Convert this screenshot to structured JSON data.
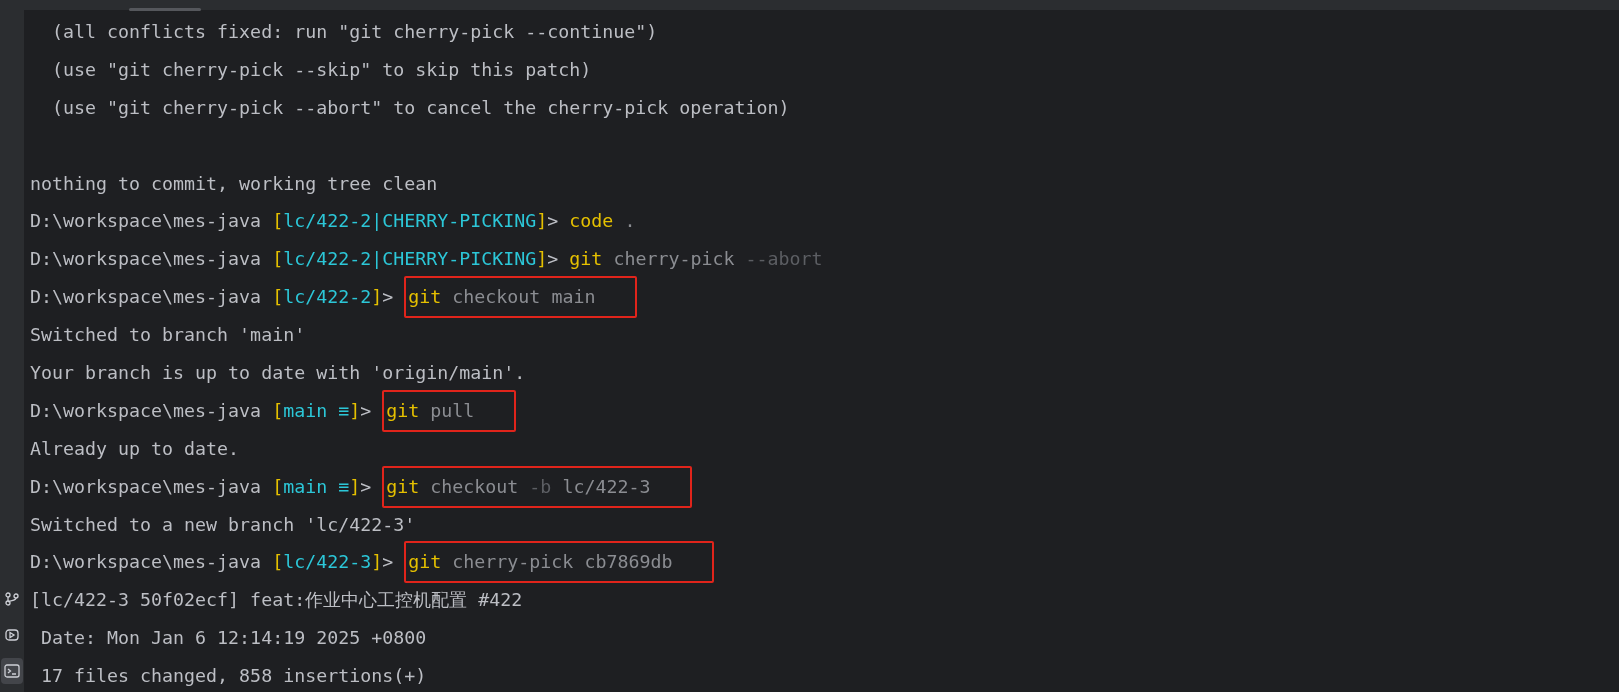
{
  "sidebar": {
    "items": [
      {
        "kind": "branch",
        "selected": false
      },
      {
        "kind": "run",
        "selected": false
      },
      {
        "kind": "terminal",
        "selected": true
      }
    ]
  },
  "terminal": {
    "lines": [
      {
        "kind": "output",
        "text": "  (all conflicts fixed: run \"git cherry-pick --continue\")"
      },
      {
        "kind": "output",
        "text": "  (use \"git cherry-pick --skip\" to skip this patch)"
      },
      {
        "kind": "output",
        "text": "  (use \"git cherry-pick --abort\" to cancel the cherry-pick operation)"
      },
      {
        "kind": "blank"
      },
      {
        "kind": "output",
        "text": "nothing to commit, working tree clean"
      },
      {
        "kind": "prompt",
        "prompt": [
          {
            "kind": "path",
            "text": "D:\\workspace\\mes-java "
          },
          {
            "kind": "bracket",
            "text": "["
          },
          {
            "kind": "branch",
            "text": "lc/422-2|CHERRY-PICKING"
          },
          {
            "kind": "bracket",
            "text": "]"
          },
          {
            "kind": "arrow",
            "text": "> "
          }
        ],
        "highlighted": false,
        "command": [
          {
            "kind": "command",
            "text": "code"
          },
          {
            "kind": "arg",
            "text": "."
          }
        ]
      },
      {
        "kind": "prompt",
        "prompt": [
          {
            "kind": "path",
            "text": "D:\\workspace\\mes-java "
          },
          {
            "kind": "bracket",
            "text": "["
          },
          {
            "kind": "branch",
            "text": "lc/422-2|CHERRY-PICKING"
          },
          {
            "kind": "bracket",
            "text": "]"
          },
          {
            "kind": "arrow",
            "text": "> "
          }
        ],
        "highlighted": false,
        "command": [
          {
            "kind": "command",
            "text": "git"
          },
          {
            "kind": "arg",
            "text": "cherry-pick"
          },
          {
            "kind": "option",
            "text": "--abort"
          }
        ]
      },
      {
        "kind": "prompt",
        "prompt": [
          {
            "kind": "path",
            "text": "D:\\workspace\\mes-java "
          },
          {
            "kind": "bracket",
            "text": "["
          },
          {
            "kind": "branch",
            "text": "lc/422-2"
          },
          {
            "kind": "bracket",
            "text": "]"
          },
          {
            "kind": "arrow",
            "text": "> "
          }
        ],
        "highlighted": true,
        "command": [
          {
            "kind": "command",
            "text": "git"
          },
          {
            "kind": "arg",
            "text": "checkout"
          },
          {
            "kind": "arg",
            "text": "main"
          }
        ]
      },
      {
        "kind": "output",
        "text": "Switched to branch 'main'"
      },
      {
        "kind": "output",
        "text": "Your branch is up to date with 'origin/main'."
      },
      {
        "kind": "prompt",
        "prompt": [
          {
            "kind": "path",
            "text": "D:\\workspace\\mes-java "
          },
          {
            "kind": "bracket",
            "text": "["
          },
          {
            "kind": "branch",
            "text": "main ≡"
          },
          {
            "kind": "bracket",
            "text": "]"
          },
          {
            "kind": "arrow",
            "text": "> "
          }
        ],
        "highlighted": true,
        "command": [
          {
            "kind": "command",
            "text": "git"
          },
          {
            "kind": "arg",
            "text": "pull"
          }
        ]
      },
      {
        "kind": "output",
        "text": "Already up to date."
      },
      {
        "kind": "prompt",
        "prompt": [
          {
            "kind": "path",
            "text": "D:\\workspace\\mes-java "
          },
          {
            "kind": "bracket",
            "text": "["
          },
          {
            "kind": "branch",
            "text": "main ≡"
          },
          {
            "kind": "bracket",
            "text": "]"
          },
          {
            "kind": "arrow",
            "text": "> "
          }
        ],
        "highlighted": true,
        "command": [
          {
            "kind": "command",
            "text": "git"
          },
          {
            "kind": "arg",
            "text": "checkout"
          },
          {
            "kind": "option",
            "text": "-b"
          },
          {
            "kind": "arg",
            "text": "lc/422-3"
          }
        ]
      },
      {
        "kind": "output",
        "text": "Switched to a new branch 'lc/422-3'"
      },
      {
        "kind": "prompt",
        "prompt": [
          {
            "kind": "path",
            "text": "D:\\workspace\\mes-java "
          },
          {
            "kind": "bracket",
            "text": "["
          },
          {
            "kind": "branch",
            "text": "lc/422-3"
          },
          {
            "kind": "bracket",
            "text": "]"
          },
          {
            "kind": "arrow",
            "text": "> "
          }
        ],
        "highlighted": true,
        "command": [
          {
            "kind": "command",
            "text": "git"
          },
          {
            "kind": "arg",
            "text": "cherry-pick"
          },
          {
            "kind": "arg",
            "text": "cb7869db"
          }
        ]
      },
      {
        "kind": "output",
        "text": "[lc/422-3 50f02ecf] feat:作业中心工控机配置 #422"
      },
      {
        "kind": "output",
        "text": " Date: Mon Jan 6 12:14:19 2025 +0800"
      },
      {
        "kind": "output",
        "text": " 17 files changed, 858 insertions(+)"
      }
    ]
  }
}
